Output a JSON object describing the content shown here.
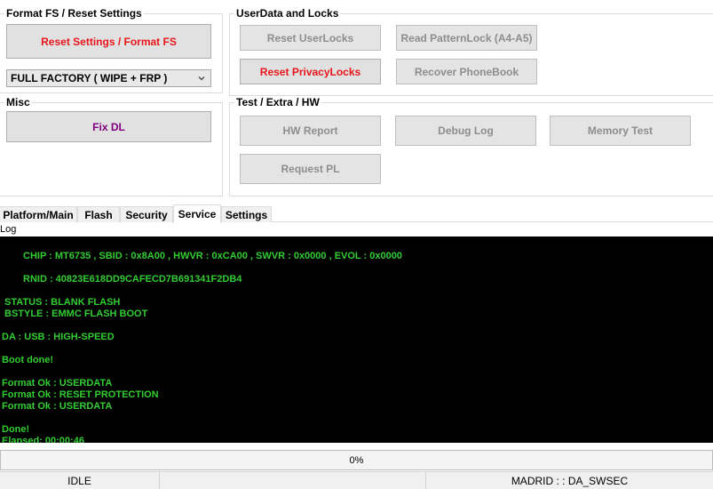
{
  "format_group": {
    "title": "Format FS / Reset Settings",
    "reset_button": "Reset Settings / Format FS",
    "mode_select": "FULL FACTORY ( WIPE + FRP )"
  },
  "misc_group": {
    "title": "Misc",
    "fix_dl_button": "Fix DL"
  },
  "userdata_group": {
    "title": "UserData  and Locks",
    "reset_userlocks": "Reset UserLocks",
    "read_patternlock": "Read PatternLock (A4-A5)",
    "reset_privacylocks": "Reset PrivacyLocks",
    "recover_phonebook": "Recover PhoneBook"
  },
  "test_group": {
    "title": "Test / Extra / HW",
    "hw_report": "HW Report",
    "debug_log": "Debug Log",
    "memory_test": "Memory Test",
    "request_pl": "Request PL"
  },
  "tabs": [
    "Platform/Main",
    "Flash",
    "Security",
    "Service",
    "Settings"
  ],
  "active_tab": "Service",
  "log": {
    "label": "Log",
    "lines": [
      "CHIP : MT6735 , SBID : 0x8A00 , HWVR : 0xCA00 , SWVR : 0x0000 , EVOL : 0x0000",
      "RNID : 40823E618DD9CAFECD7B691341F2DB4",
      "STATUS : BLANK FLASH",
      "BSTYLE : EMMC FLASH BOOT",
      "DA : USB : HIGH-SPEED",
      "Boot done!",
      "Format Ok : USERDATA",
      "Format Ok : RESET PROTECTION",
      "Format Ok : USERDATA",
      "Done!",
      "Elapsed: 00:00:46"
    ]
  },
  "progress": {
    "value": 0,
    "text": "0%"
  },
  "status": {
    "state": "IDLE",
    "middle": "",
    "device": "MADRID : : DA_SWSEC"
  },
  "colors": {
    "log_text": "#32cd32",
    "log_bg": "#000000",
    "red_label": "#e8161b",
    "purple_label": "#800080"
  }
}
